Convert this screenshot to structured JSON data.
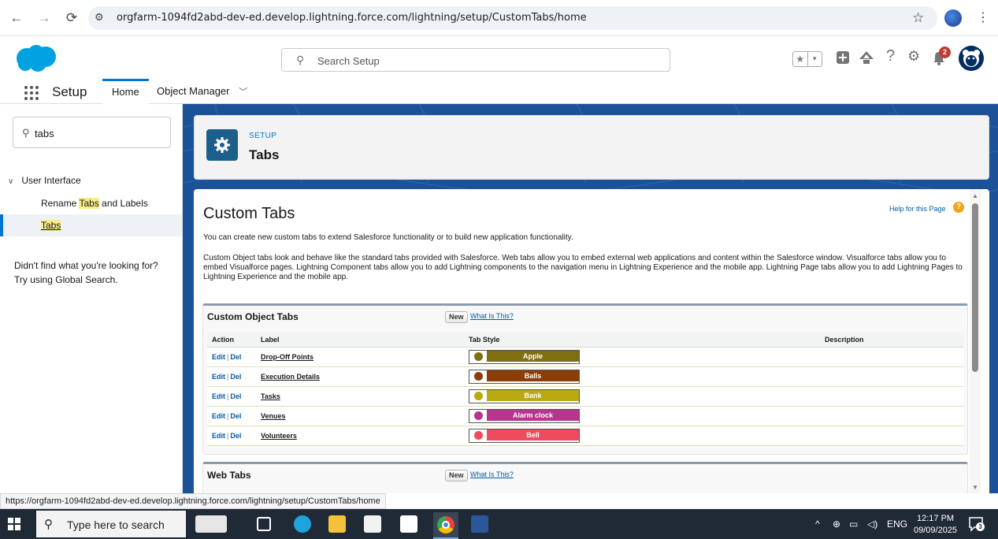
{
  "browser": {
    "url": "orgfarm-1094fd2abd-dev-ed.develop.lightning.force.com/lightning/setup/CustomTabs/home",
    "status_url": "https://orgfarm-1094fd2abd-dev-ed.develop.lightning.force.com/lightning/setup/CustomTabs/home"
  },
  "header": {
    "search_placeholder": "Search Setup",
    "notification_count": "2",
    "help_glyph": "?",
    "brand_color": "#00a1e0"
  },
  "appnav": {
    "app_name": "Setup",
    "tabs": [
      {
        "label": "Home",
        "active": true
      },
      {
        "label": "Object Manager",
        "active": false
      }
    ]
  },
  "sidebar": {
    "quickfind_value": "tabs",
    "group_label": "User Interface",
    "items": [
      {
        "pre": "Rename ",
        "match": "Tabs",
        "post": " and Labels",
        "selected": false
      },
      {
        "pre": "",
        "match": "Tabs",
        "post": "",
        "selected": true
      }
    ],
    "help_line1": "Didn't find what you're looking for?",
    "help_line2": "Try using Global Search."
  },
  "page_header": {
    "eyebrow": "SETUP",
    "title": "Tabs"
  },
  "content": {
    "title": "Custom Tabs",
    "help_link": "Help for this Page",
    "help_glyph": "?",
    "para1": "You can create new custom tabs to extend Salesforce functionality or to build new application functionality.",
    "para2": "Custom Object tabs look and behave like the standard tabs provided with Salesforce. Web tabs allow you to embed external web applications and content within the Salesforce window. Visualforce tabs allow you to embed Visualforce pages. Lightning Component tabs allow you to add Lightning components to the navigation menu in Lightning Experience and the mobile app. Lightning Page tabs allow you to add Lightning Pages to Lightning Experience and the mobile app."
  },
  "custom_object_tabs": {
    "title": "Custom Object Tabs",
    "new_label": "New",
    "what_label": "What Is This?",
    "columns": [
      "Action",
      "Label",
      "Tab Style",
      "Description"
    ],
    "edit_label": "Edit",
    "del_label": "Del",
    "separator": "|",
    "rows": [
      {
        "label": "Drop-Off Points",
        "style": "Apple",
        "color": "#7f6f12",
        "icon": "apple-icon",
        "description": ""
      },
      {
        "label": "Execution Details",
        "style": "Balls",
        "color": "#8a3f08",
        "icon": "balls-icon",
        "description": ""
      },
      {
        "label": "Tasks",
        "style": "Bank",
        "color": "#b9aa12",
        "icon": "bank-icon",
        "description": ""
      },
      {
        "label": "Venues",
        "style": "Alarm clock",
        "color": "#b7348f",
        "icon": "alarm-clock-icon",
        "description": ""
      },
      {
        "label": "Volunteers",
        "style": "Bell",
        "color": "#ef4a5e",
        "icon": "bell-icon",
        "description": ""
      }
    ]
  },
  "web_tabs": {
    "title": "Web Tabs",
    "new_label": "New",
    "what_label": "What Is This?"
  },
  "taskbar": {
    "search_placeholder": "Type here to search",
    "language": "ENG",
    "time": "12:17 PM",
    "date": "09/09/2025",
    "notification_count": "3"
  }
}
